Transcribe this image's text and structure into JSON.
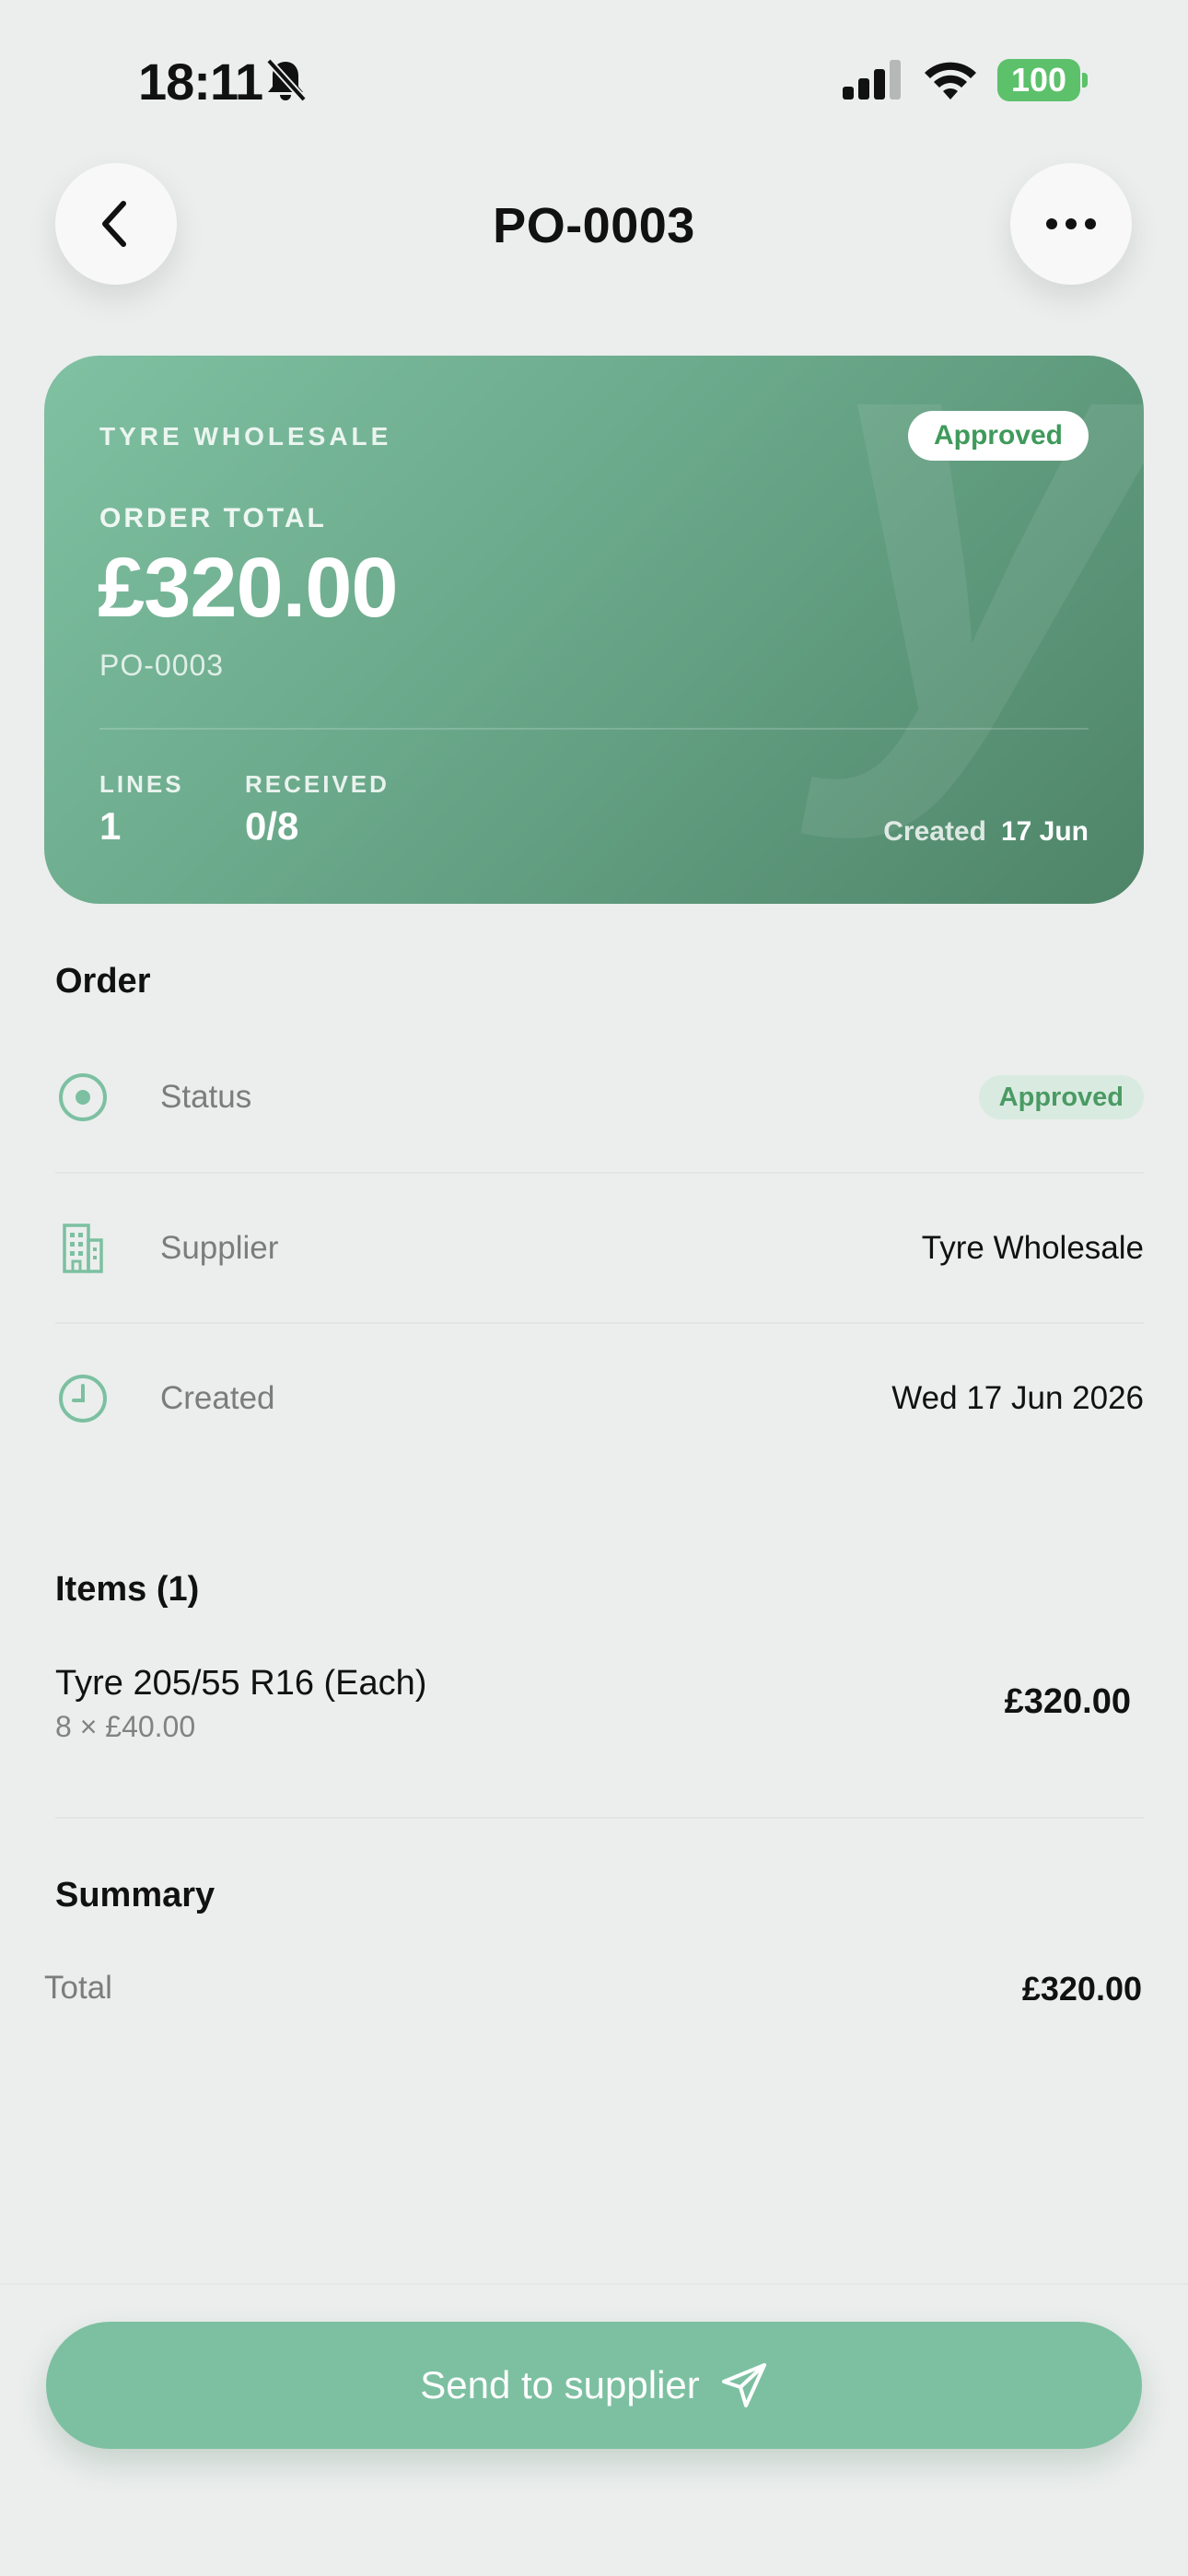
{
  "status_bar": {
    "time": "18:11",
    "battery": "100"
  },
  "header": {
    "title": "PO-0003"
  },
  "hero": {
    "supplier": "TYRE WHOLESALE",
    "badge": "Approved",
    "total_label": "ORDER TOTAL",
    "total": "£320.00",
    "po_number": "PO-0003",
    "watermark": "y",
    "lines_label": "LINES",
    "lines_value": "1",
    "received_label": "RECEIVED",
    "received_value": "0/8",
    "created_label": "Created",
    "created_value": "17 Jun"
  },
  "order": {
    "title": "Order",
    "rows": [
      {
        "label": "Status",
        "value": "Approved",
        "icon": "status-dot-icon"
      },
      {
        "label": "Supplier",
        "value": "Tyre Wholesale",
        "icon": "building-icon"
      },
      {
        "label": "Created",
        "value": "Wed 17 Jun 2026",
        "icon": "clock-icon"
      }
    ]
  },
  "items": {
    "title": "Items (1)",
    "list": [
      {
        "name": "Tyre 205/55 R16 (Each)",
        "qty": "8 × £40.00",
        "price": "£320.00"
      }
    ]
  },
  "summary": {
    "title": "Summary",
    "total_label": "Total",
    "total_value": "£320.00"
  },
  "actions": {
    "send_label": "Send to supplier"
  },
  "colors": {
    "accent": "#7cc0a1",
    "card_start": "#7fc1a2",
    "card_end": "#4e8468",
    "approved": "#4a9a64",
    "background": "#ebeeed"
  }
}
